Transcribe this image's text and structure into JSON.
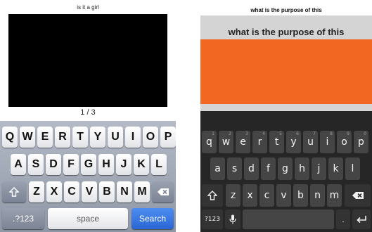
{
  "left": {
    "title": "is it a girl",
    "page_indicator": "1 / 3",
    "keyboard": {
      "row1": [
        "Q",
        "W",
        "E",
        "R",
        "T",
        "Y",
        "U",
        "I",
        "O",
        "P"
      ],
      "row2": [
        "A",
        "S",
        "D",
        "F",
        "G",
        "H",
        "J",
        "K",
        "L"
      ],
      "row3": [
        "Z",
        "X",
        "C",
        "V",
        "B",
        "N",
        "M"
      ],
      "shift_icon": "shift-arrow-icon",
      "delete_icon": "backspace-icon",
      "numbers_label": ".?123",
      "space_label": "space",
      "search_label": "Search"
    }
  },
  "right": {
    "title_small": "what is the purpose of this",
    "title_large": "what is the purpose of this",
    "accent_color": "#f26722",
    "keyboard": {
      "row1": [
        "q",
        "w",
        "e",
        "r",
        "t",
        "y",
        "u",
        "i",
        "o",
        "p"
      ],
      "row1_hints": [
        "1",
        "2",
        "3",
        "4",
        "5",
        "6",
        "7",
        "8",
        "9",
        "0"
      ],
      "row2": [
        "a",
        "s",
        "d",
        "f",
        "g",
        "h",
        "j",
        "k",
        "l"
      ],
      "row3": [
        "z",
        "x",
        "c",
        "v",
        "b",
        "n",
        "m"
      ],
      "shift_icon": "shift-arrow-icon",
      "delete_icon": "backspace-icon",
      "numbers_label": "?123",
      "mic_icon": "microphone-icon",
      "period_label": ".",
      "enter_icon": "enter-arrow-icon"
    }
  }
}
